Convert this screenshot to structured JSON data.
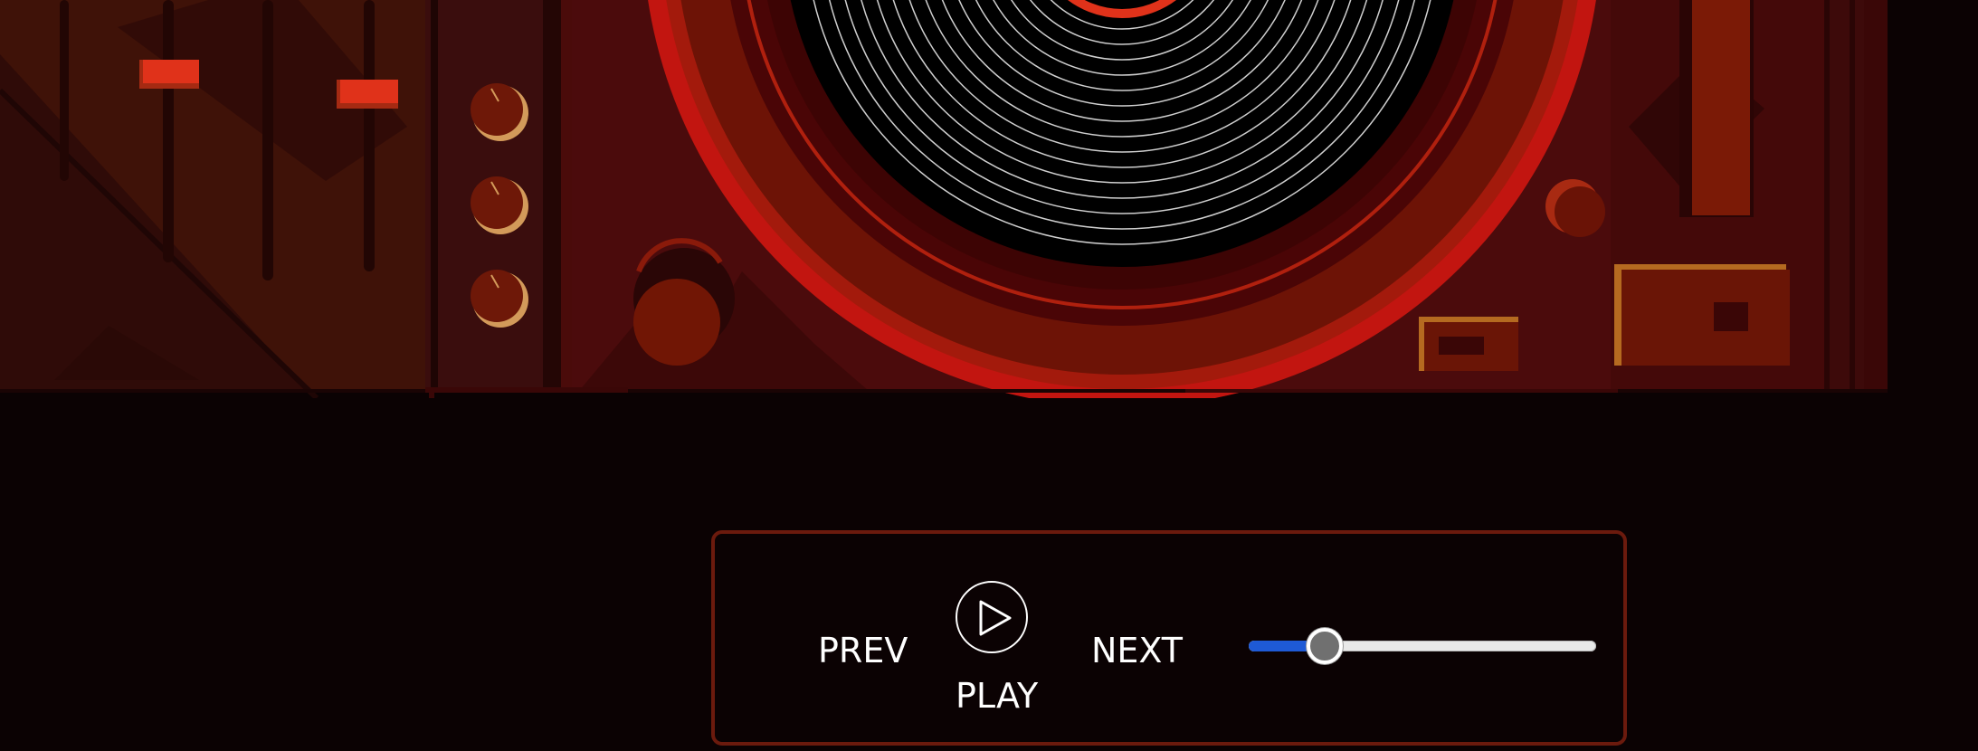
{
  "controls": {
    "prev_label": "PREV",
    "play_label": "PLAY",
    "next_label": "NEXT",
    "play_icon": "play-circle-icon",
    "slider_value_fraction": 0.22
  },
  "colors": {
    "background": "#0b0203",
    "panel_border": "#6b1a0d",
    "slider_fill": "#1e5ad6",
    "text": "#ffffff"
  }
}
